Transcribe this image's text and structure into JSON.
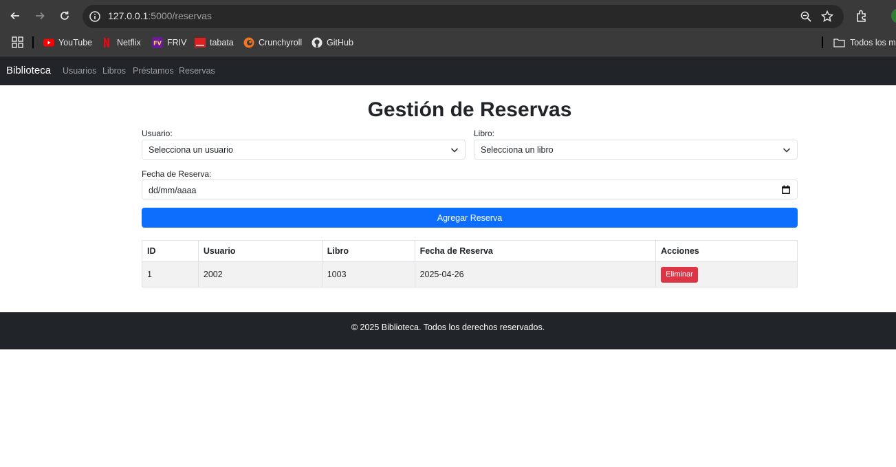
{
  "browser": {
    "url_host": "127.0.0.1",
    "url_path": ":5000/reservas",
    "bookmarks": [
      {
        "label": "YouTube",
        "icon": "youtube-icon"
      },
      {
        "label": "Netflix",
        "icon": "netflix-icon"
      },
      {
        "label": "FRIV",
        "icon": "friv-icon"
      },
      {
        "label": "tabata",
        "icon": "tabata-icon"
      },
      {
        "label": "Crunchyroll",
        "icon": "crunchyroll-icon"
      },
      {
        "label": "GitHub",
        "icon": "github-icon"
      }
    ],
    "folder_label": "Todos los ma"
  },
  "navbar": {
    "brand": "Biblioteca",
    "links": [
      "Usuarios",
      "Libros",
      "Préstamos",
      "Reservas"
    ]
  },
  "main": {
    "title": "Gestión de Reservas",
    "usuario_label": "Usuario:",
    "usuario_value": "Selecciona un usuario",
    "libro_label": "Libro:",
    "libro_value": "Selecciona un libro",
    "fecha_label": "Fecha de Reserva:",
    "fecha_placeholder": "dd/mm/aaaa",
    "submit_label": "Agregar Reserva",
    "table": {
      "headers": [
        "ID",
        "Usuario",
        "Libro",
        "Fecha de Reserva",
        "Acciones"
      ],
      "rows": [
        {
          "id": "1",
          "usuario": "2002",
          "libro": "1003",
          "fecha": "2025-04-26",
          "action": "Eliminar"
        }
      ]
    }
  },
  "footer": {
    "text": "© 2025 Biblioteca. Todos los derechos reservados."
  },
  "colors": {
    "primary": "#0d6efd",
    "danger": "#dc3545",
    "dark": "#212529"
  }
}
